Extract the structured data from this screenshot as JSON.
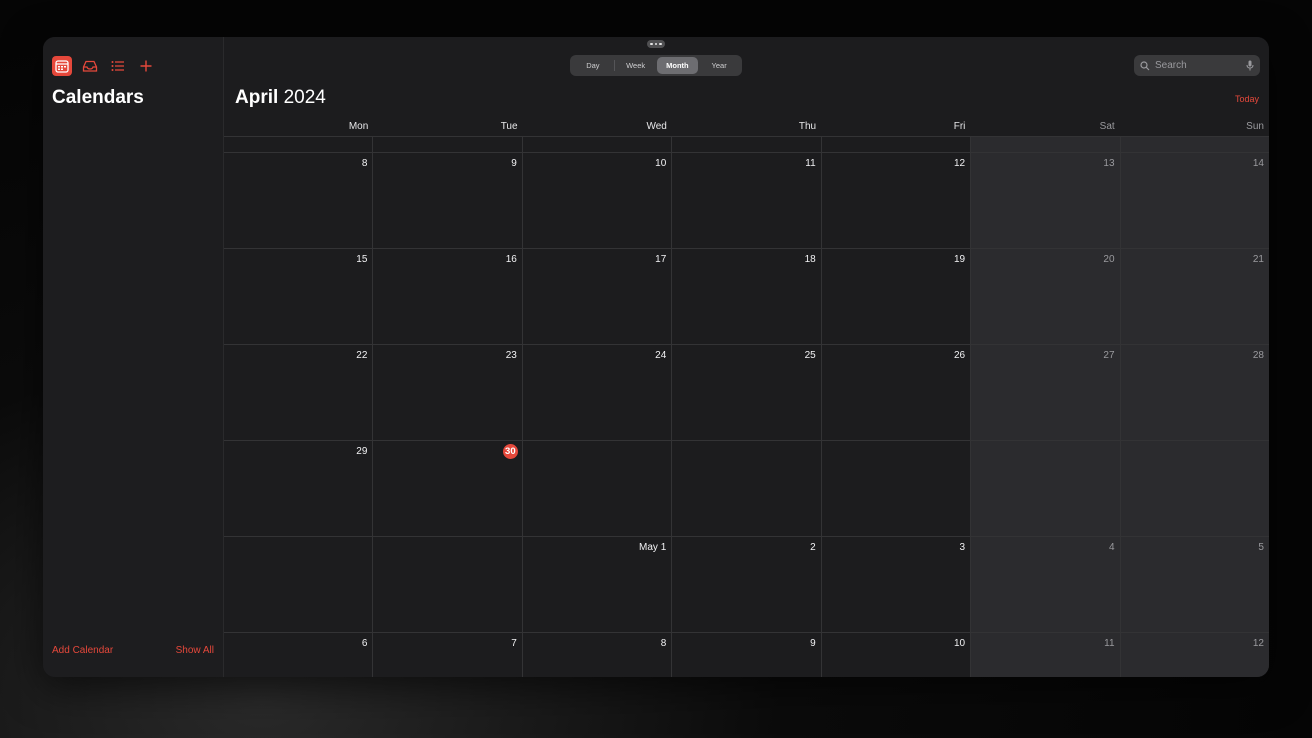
{
  "sidebar": {
    "title": "Calendars",
    "add_calendar": "Add Calendar",
    "show_all": "Show All",
    "tools": [
      "calendar-icon",
      "inbox-icon",
      "list-icon",
      "plus-icon"
    ]
  },
  "toolbar": {
    "views": [
      "Day",
      "Week",
      "Month",
      "Year"
    ],
    "selected_view": "Month",
    "search_placeholder": "Search"
  },
  "header": {
    "month": "April",
    "year": "2024",
    "today_label": "Today"
  },
  "weekdays": [
    "Mon",
    "Tue",
    "Wed",
    "Thu",
    "Fri",
    "Sat",
    "Sun"
  ],
  "weeks": [
    [
      "8",
      "9",
      "10",
      "11",
      "12",
      "13",
      "14"
    ],
    [
      "15",
      "16",
      "17",
      "18",
      "19",
      "20",
      "21"
    ],
    [
      "22",
      "23",
      "24",
      "25",
      "26",
      "27",
      "28"
    ],
    [
      "29",
      "30",
      "",
      "",
      "",
      "",
      ""
    ],
    [
      "",
      "",
      "May 1",
      "2",
      "3",
      "4",
      "5"
    ],
    [
      "6",
      "7",
      "8",
      "9",
      "10",
      "11",
      "12"
    ]
  ],
  "today_date": "30",
  "colors": {
    "accent": "#e5483b",
    "background": "#1c1c1e",
    "weekend": "#2b2b2e"
  }
}
